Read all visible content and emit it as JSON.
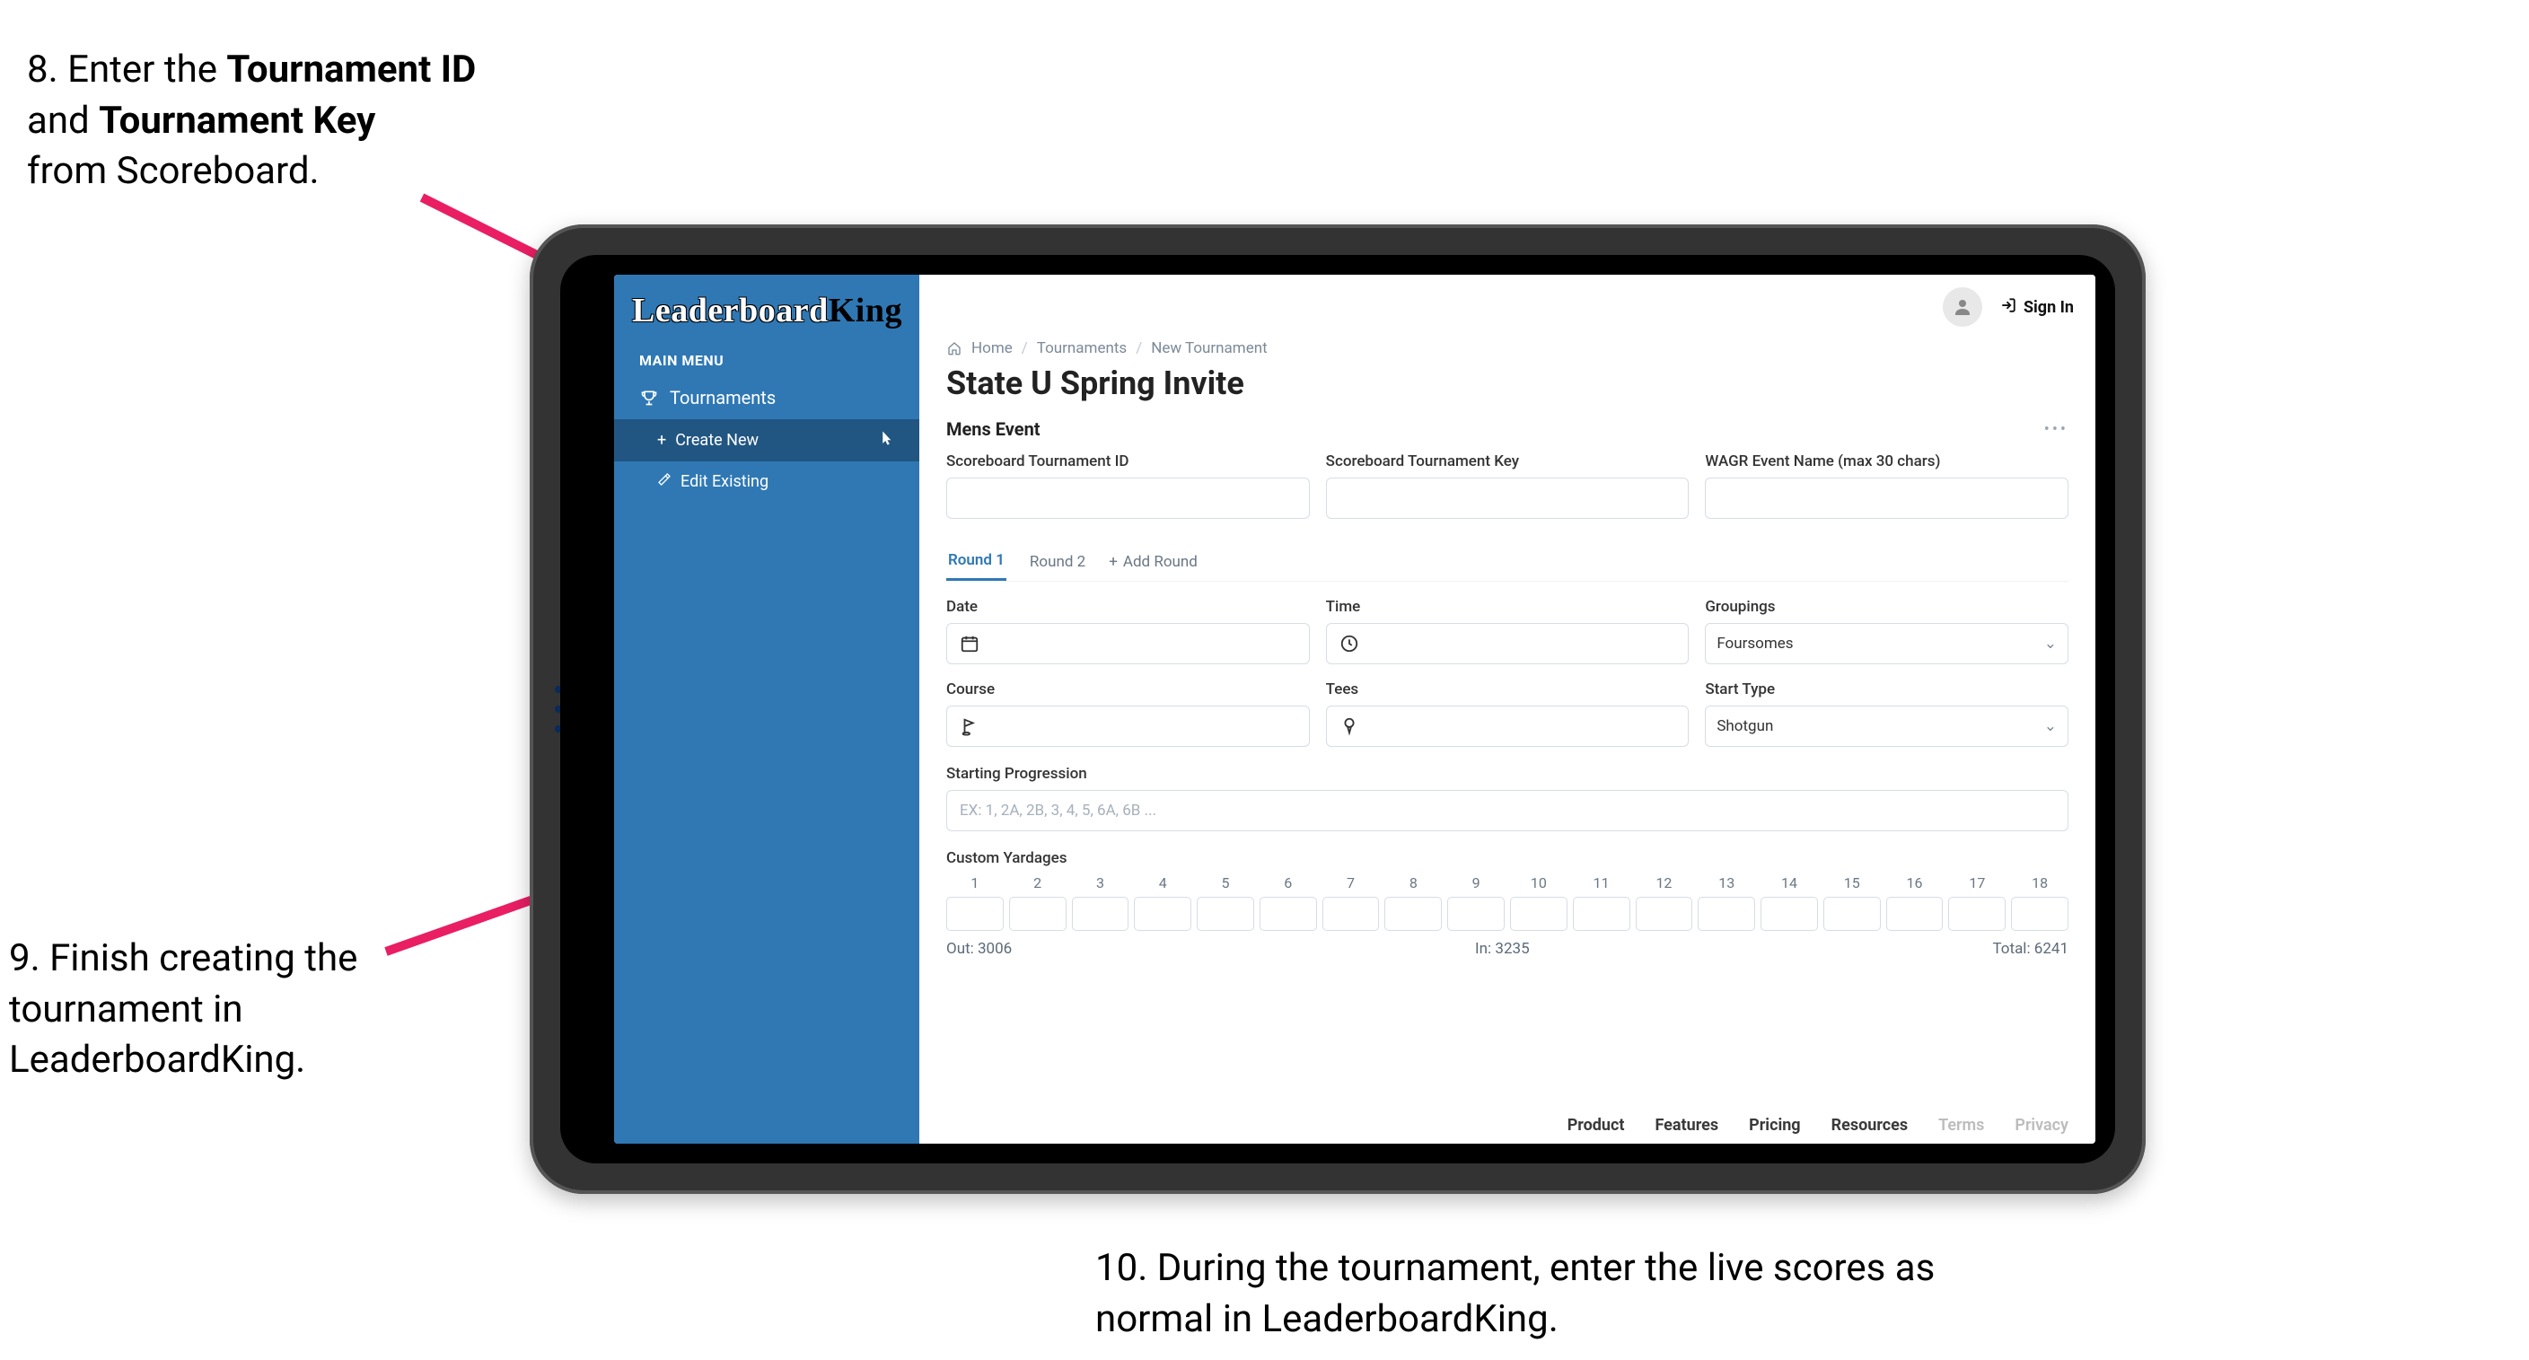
{
  "callouts": {
    "step8_pre": "8. Enter the ",
    "step8_b1": "Tournament ID",
    "step8_mid": " and ",
    "step8_b2": "Tournament Key",
    "step8_post": " from Scoreboard.",
    "step9": "9. Finish creating the tournament in LeaderboardKing.",
    "step10": "10. During the tournament, enter the live scores as normal in LeaderboardKing."
  },
  "logo": {
    "part1": "Leaderboard",
    "part2": "King"
  },
  "sidebar": {
    "menuLabel": "MAIN MENU",
    "tournaments": "Tournaments",
    "createNew": "Create New",
    "editExisting": "Edit Existing"
  },
  "topbar": {
    "signIn": "Sign In"
  },
  "breadcrumb": {
    "home": "Home",
    "tournaments": "Tournaments",
    "newTournament": "New Tournament"
  },
  "pageTitle": "State U Spring Invite",
  "section": {
    "title": "Mens Event"
  },
  "labels": {
    "scoreboardId": "Scoreboard Tournament ID",
    "scoreboardKey": "Scoreboard Tournament Key",
    "wagr": "WAGR Event Name (max 30 chars)",
    "date": "Date",
    "time": "Time",
    "groupings": "Groupings",
    "course": "Course",
    "tees": "Tees",
    "startType": "Start Type",
    "startingProgression": "Starting Progression",
    "customYardages": "Custom Yardages"
  },
  "tabs": {
    "round1": "Round 1",
    "round2": "Round 2",
    "addRound": "Add Round"
  },
  "selects": {
    "groupings": "Foursomes",
    "startType": "Shotgun"
  },
  "placeholders": {
    "progression": "EX: 1, 2A, 2B, 3, 4, 5, 6A, 6B ..."
  },
  "holes": [
    "1",
    "2",
    "3",
    "4",
    "5",
    "6",
    "7",
    "8",
    "9",
    "10",
    "11",
    "12",
    "13",
    "14",
    "15",
    "16",
    "17",
    "18"
  ],
  "totals": {
    "outLabel": "Out:",
    "outVal": "3006",
    "inLabel": "In:",
    "inVal": "3235",
    "totalLabel": "Total:",
    "totalVal": "6241"
  },
  "footer": [
    "Product",
    "Features",
    "Pricing",
    "Resources",
    "Terms",
    "Privacy"
  ]
}
